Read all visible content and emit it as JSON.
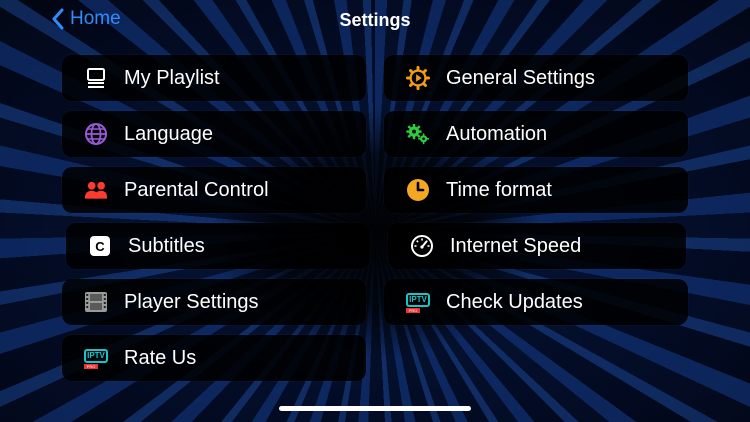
{
  "header": {
    "back_label": "Home",
    "title": "Settings"
  },
  "left_items": [
    {
      "label": "My Playlist",
      "icon": "playlist-icon"
    },
    {
      "label": "Language",
      "icon": "globe-icon"
    },
    {
      "label": "Parental Control",
      "icon": "users-icon"
    },
    {
      "label": "Subtitles",
      "icon": "subtitles-icon"
    },
    {
      "label": "Player Settings",
      "icon": "film-icon"
    },
    {
      "label": "Rate Us",
      "icon": "iptv-icon"
    }
  ],
  "right_items": [
    {
      "label": "General Settings",
      "icon": "gear-icon"
    },
    {
      "label": "Automation",
      "icon": "gears-icon"
    },
    {
      "label": "Time format",
      "icon": "clock-icon"
    },
    {
      "label": "Internet Speed",
      "icon": "speedometer-icon"
    },
    {
      "label": "Check Updates",
      "icon": "iptv-icon"
    }
  ],
  "icon_text": {
    "subtitles": "C",
    "iptv": "IPTV",
    "iptv_badge": "PRO"
  },
  "colors": {
    "accent_blue": "#2f8cff",
    "globe": "#9b59d6",
    "users": "#ff3b30",
    "gear_orange": "#f39c12",
    "gears_green": "#2ecc40",
    "clock_orange": "#f5a623",
    "iptv_teal": "#18c6c6"
  }
}
